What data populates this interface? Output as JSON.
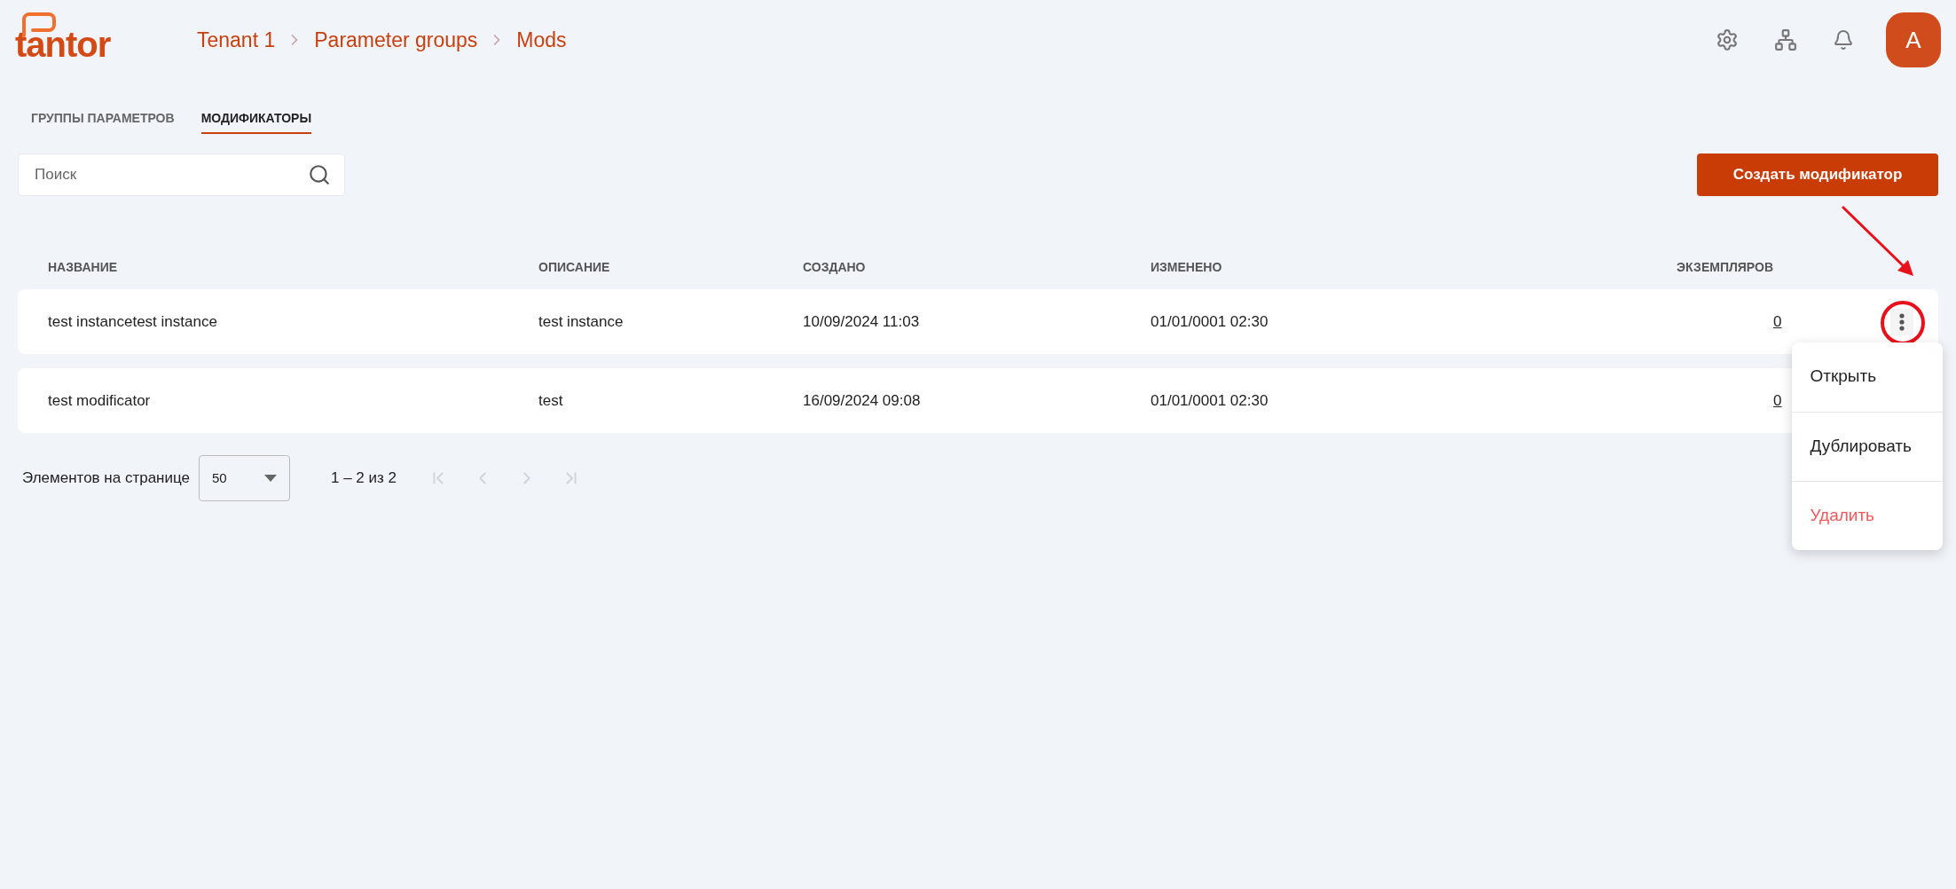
{
  "logo": "tantor",
  "breadcrumbs": [
    "Tenant 1",
    "Parameter groups",
    "Mods"
  ],
  "user": {
    "avatar": "A"
  },
  "tabs": [
    {
      "label": "ГРУППЫ ПАРАМЕТРОВ",
      "selected": false
    },
    {
      "label": "МОДИФИКАТОРЫ",
      "selected": true
    }
  ],
  "search": {
    "placeholder": "Поиск"
  },
  "create_button": "Создать модификатор",
  "table": {
    "columns": [
      "НАЗВАНИЕ",
      "ОПИСАНИЕ",
      "СОЗДАНО",
      "ИЗМЕНЕНО",
      "ЭКЗЕМПЛЯРОВ"
    ],
    "rows": [
      {
        "name": "test instancetest instance",
        "description": "test instance",
        "created": "10/09/2024 11:03",
        "modified": "01/01/0001 02:30",
        "instances": "0",
        "menu_open": true
      },
      {
        "name": "test modificator",
        "description": "test",
        "created": "16/09/2024 09:08",
        "modified": "01/01/0001 02:30",
        "instances": "0",
        "menu_open": false
      }
    ]
  },
  "row_menu": [
    {
      "label": "Открыть",
      "kind": "normal"
    },
    {
      "label": "Дублировать",
      "kind": "normal"
    },
    {
      "label": "Удалить",
      "kind": "danger"
    }
  ],
  "pagination": {
    "label": "Элементов на странице",
    "page_size": "50",
    "range": "1 – 2 из 2",
    "nav_buttons": [
      {
        "kind": "first",
        "disabled": true
      },
      {
        "kind": "prev",
        "disabled": true
      },
      {
        "kind": "next",
        "disabled": true
      },
      {
        "kind": "last",
        "disabled": true
      }
    ]
  }
}
